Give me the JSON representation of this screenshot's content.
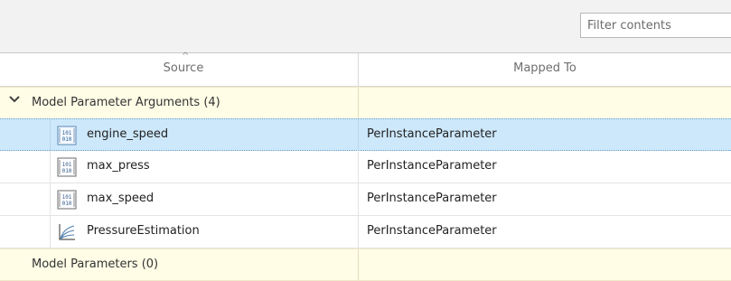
{
  "toolbar": {
    "filter_placeholder": "Filter contents"
  },
  "columns": {
    "source": "Source",
    "mapped_to": "Mapped To"
  },
  "groups": [
    {
      "label": "Model Parameter Arguments (4)",
      "expanded": true,
      "rows": [
        {
          "name": "engine_speed",
          "mapped": "PerInstanceParameter",
          "icon": "parameter-binary-icon",
          "selected": true
        },
        {
          "name": "max_press",
          "mapped": "PerInstanceParameter",
          "icon": "parameter-binary-icon",
          "selected": false
        },
        {
          "name": "max_speed",
          "mapped": "PerInstanceParameter",
          "icon": "parameter-binary-icon",
          "selected": false
        },
        {
          "name": "PressureEstimation",
          "mapped": "PerInstanceParameter",
          "icon": "lookup-table-icon",
          "selected": false
        }
      ]
    },
    {
      "label": "Model Parameters (0)",
      "expanded": false,
      "rows": []
    }
  ],
  "colors": {
    "selection": "#cde8fb",
    "group_background": "#fffde6",
    "toolbar_background": "#f2f2f2"
  }
}
